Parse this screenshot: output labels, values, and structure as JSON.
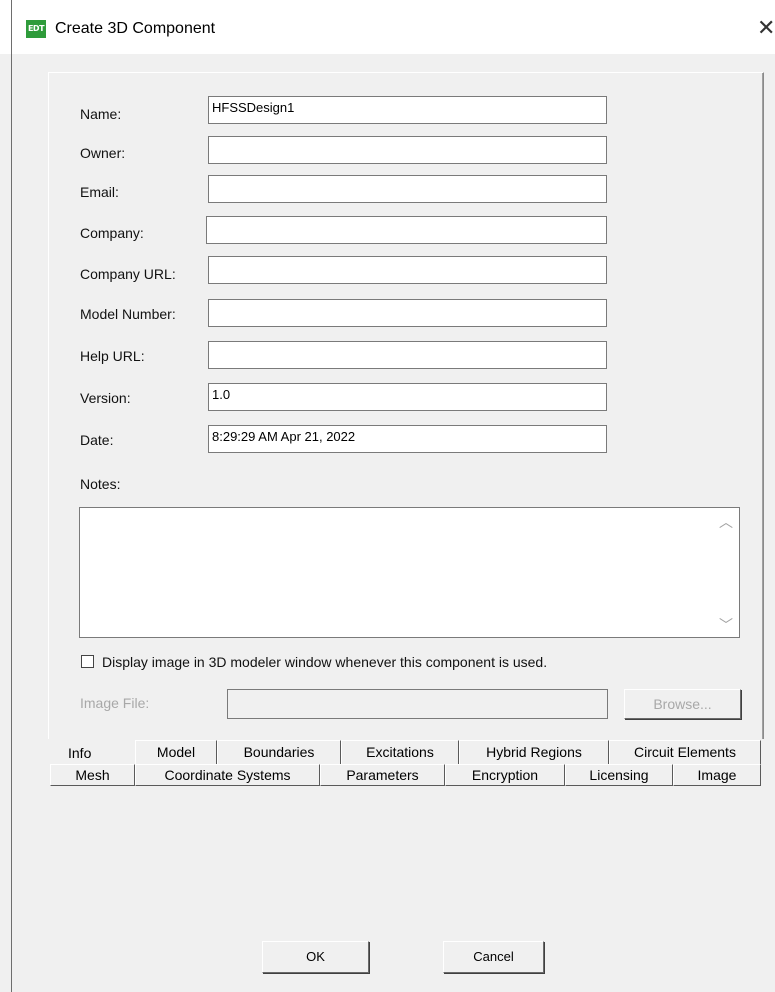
{
  "window": {
    "icon_text": "EDT",
    "title": "Create 3D Component",
    "close_glyph": "✕"
  },
  "form": {
    "name_label": "Name:",
    "name_value": "HFSSDesign1",
    "owner_label": "Owner:",
    "owner_value": "",
    "email_label": "Email:",
    "email_value": "",
    "company_label": "Company:",
    "company_value": "",
    "company_url_label": "Company URL:",
    "company_url_value": "",
    "model_number_label": "Model Number:",
    "model_number_value": "",
    "help_url_label": "Help URL:",
    "help_url_value": "",
    "version_label": "Version:",
    "version_value": "1.0",
    "date_label": "Date:",
    "date_value": "8:29:29 AM  Apr 21, 2022",
    "notes_label": "Notes:",
    "notes_value": "",
    "display_image_label": "Display image in 3D modeler window whenever this component is used.",
    "display_image_checked": false,
    "image_file_label": "Image File:",
    "image_file_value": "",
    "browse_label": "Browse..."
  },
  "tabs": {
    "row1": [
      "Info",
      "Model",
      "Boundaries",
      "Excitations",
      "Hybrid Regions",
      "Circuit Elements"
    ],
    "row2": [
      "Mesh",
      "Coordinate Systems",
      "Parameters",
      "Encryption",
      "Licensing",
      "Image"
    ],
    "active": "Info"
  },
  "buttons": {
    "ok": "OK",
    "cancel": "Cancel"
  },
  "icons": {
    "app": "edt-app-icon",
    "close": "close-icon",
    "scroll_up": "chevron-up-icon",
    "scroll_down": "chevron-down-icon"
  }
}
